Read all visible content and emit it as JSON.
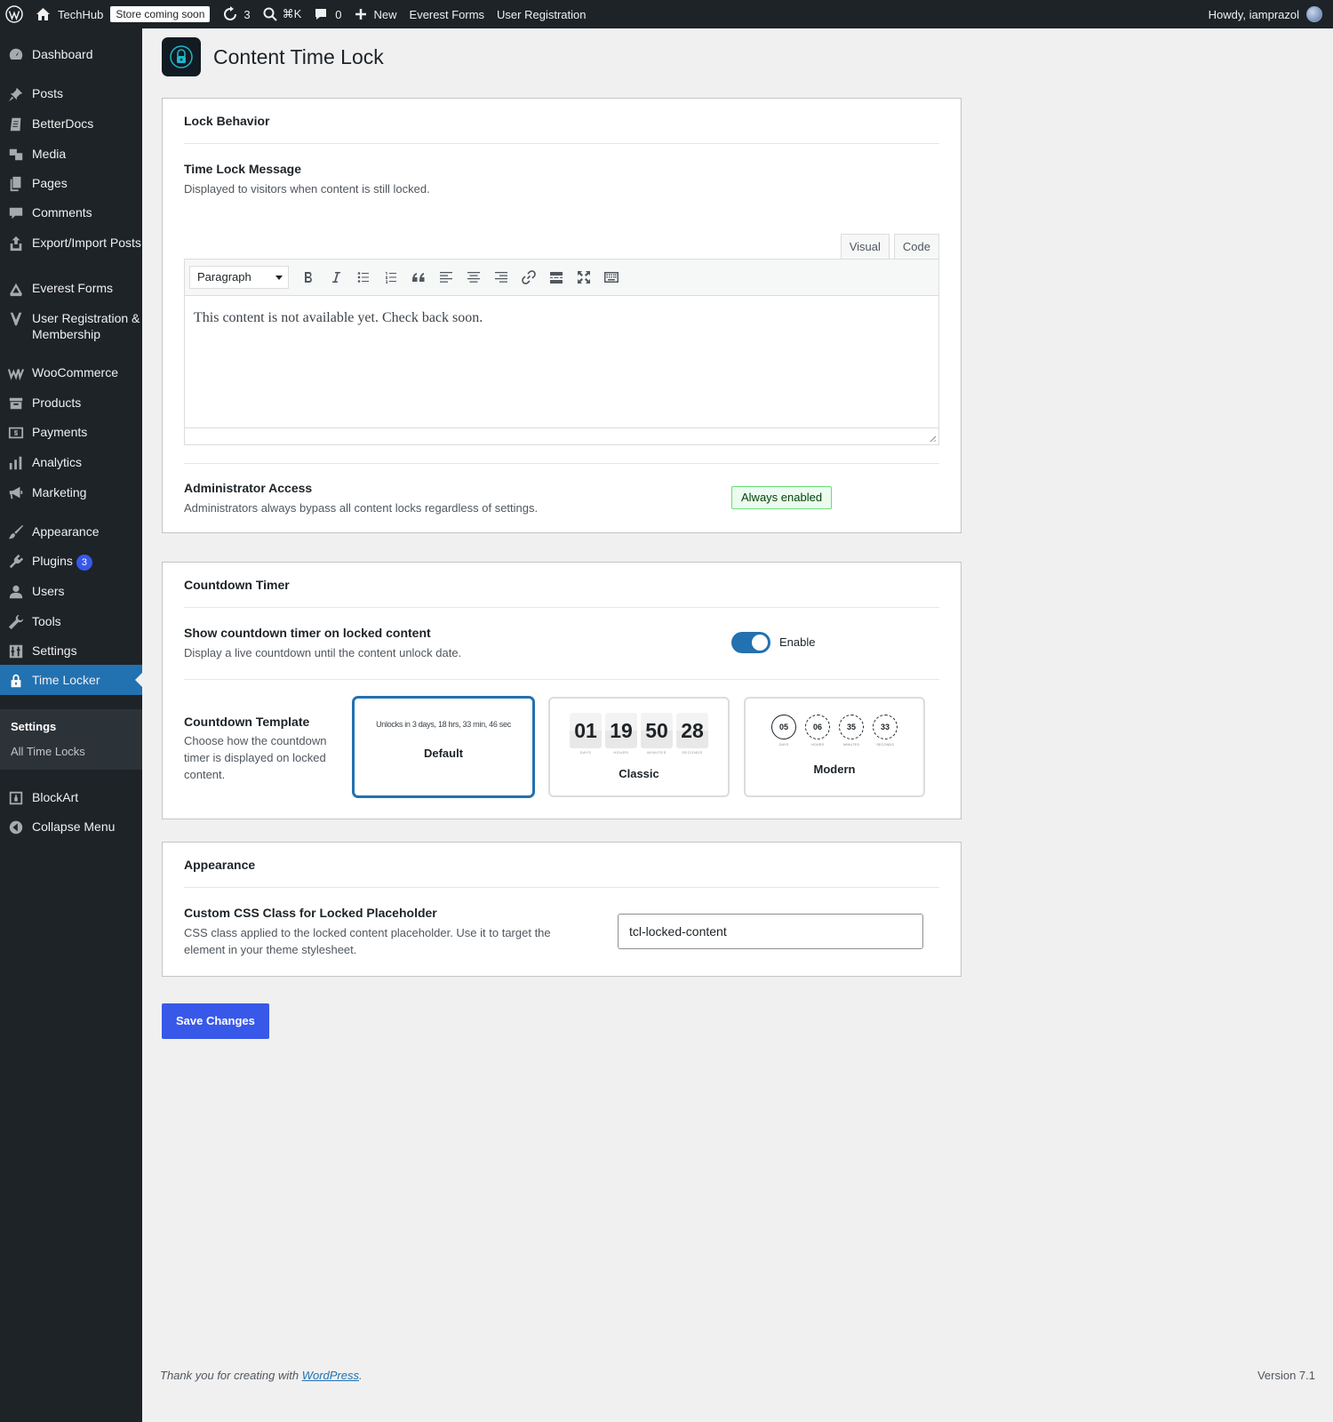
{
  "admin_bar": {
    "site_name": "TechHub",
    "store_badge": "Store coming soon",
    "updates_count": "3",
    "search_shortcut": "⌘K",
    "comments_count": "0",
    "new_label": "New",
    "everest_forms": "Everest Forms",
    "user_registration": "User Registration",
    "greeting": "Howdy, iamprazol"
  },
  "sidebar": {
    "items": [
      {
        "label": "Dashboard",
        "icon": "dashboard-icon"
      },
      {
        "label": "Posts",
        "icon": "pin-icon"
      },
      {
        "label": "BetterDocs",
        "icon": "docs-icon"
      },
      {
        "label": "Media",
        "icon": "media-icon"
      },
      {
        "label": "Pages",
        "icon": "pages-icon"
      },
      {
        "label": "Comments",
        "icon": "comment-icon"
      },
      {
        "label": "Export/Import Posts",
        "icon": "export-icon"
      },
      {
        "label": "Everest Forms",
        "icon": "forms-icon"
      },
      {
        "label": "User Registration & Membership",
        "icon": "user-reg-icon"
      },
      {
        "label": "WooCommerce",
        "icon": "woo-icon"
      },
      {
        "label": "Products",
        "icon": "products-icon"
      },
      {
        "label": "Payments",
        "icon": "payments-icon"
      },
      {
        "label": "Analytics",
        "icon": "analytics-icon"
      },
      {
        "label": "Marketing",
        "icon": "megaphone-icon"
      },
      {
        "label": "Appearance",
        "icon": "brush-icon"
      },
      {
        "label": "Plugins",
        "icon": "plugin-icon",
        "badge": "3"
      },
      {
        "label": "Users",
        "icon": "users-icon"
      },
      {
        "label": "Tools",
        "icon": "wrench-icon"
      },
      {
        "label": "Settings",
        "icon": "settings-icon"
      },
      {
        "label": "Time Locker",
        "icon": "lock-icon"
      },
      {
        "label": "BlockArt",
        "icon": "blockart-icon"
      },
      {
        "label": "Collapse Menu",
        "icon": "collapse-icon"
      }
    ],
    "submenu": [
      {
        "label": "Settings"
      },
      {
        "label": "All Time Locks"
      }
    ]
  },
  "page": {
    "title": "Content Time Lock"
  },
  "lock_behavior": {
    "section_title": "Lock Behavior",
    "message_title": "Time Lock Message",
    "message_desc": "Displayed to visitors when content is still locked.",
    "tab_visual": "Visual",
    "tab_code": "Code",
    "format_select": "Paragraph",
    "editor_content": "This content is not available yet. Check back soon.",
    "admin_title": "Administrator Access",
    "admin_desc": "Administrators always bypass all content locks regardless of settings.",
    "admin_badge": "Always enabled"
  },
  "countdown": {
    "section_title": "Countdown Timer",
    "show_title": "Show countdown timer on locked content",
    "show_desc": "Display a live countdown until the content unlock date.",
    "toggle_on": true,
    "toggle_label": "Enable",
    "template_title": "Countdown Template",
    "template_desc": "Choose how the countdown timer is displayed on locked content.",
    "templates": {
      "default": {
        "name": "Default",
        "preview": "Unlocks in 3 days, 18 hrs, 33 min, 46 sec"
      },
      "classic": {
        "name": "Classic",
        "units": [
          {
            "value": "01",
            "label": "DAYS"
          },
          {
            "value": "19",
            "label": "HOURS"
          },
          {
            "value": "50",
            "label": "MINUTES"
          },
          {
            "value": "28",
            "label": "SECONDS"
          }
        ]
      },
      "modern": {
        "name": "Modern",
        "units": [
          {
            "value": "05",
            "label": "DAYS"
          },
          {
            "value": "06",
            "label": "HOURS"
          },
          {
            "value": "35",
            "label": "MINUTES"
          },
          {
            "value": "33",
            "label": "SECONDS"
          }
        ]
      }
    },
    "selected_template": "Default"
  },
  "appearance": {
    "section_title": "Appearance",
    "css_title": "Custom CSS Class for Locked Placeholder",
    "css_desc": "CSS class applied to the locked content placeholder. Use it to target the element in your theme stylesheet.",
    "css_value": "tcl-locked-content"
  },
  "actions": {
    "save_label": "Save Changes"
  },
  "footer": {
    "thanks_prefix": "Thank you for creating with ",
    "thanks_link": "WordPress",
    "thanks_suffix": ".",
    "version": "Version 7.1"
  },
  "colors": {
    "accent": "#2271b1",
    "save_button": "#3858e9",
    "admin_bar": "#1d2327",
    "badge_green_bg": "#edfaef"
  }
}
